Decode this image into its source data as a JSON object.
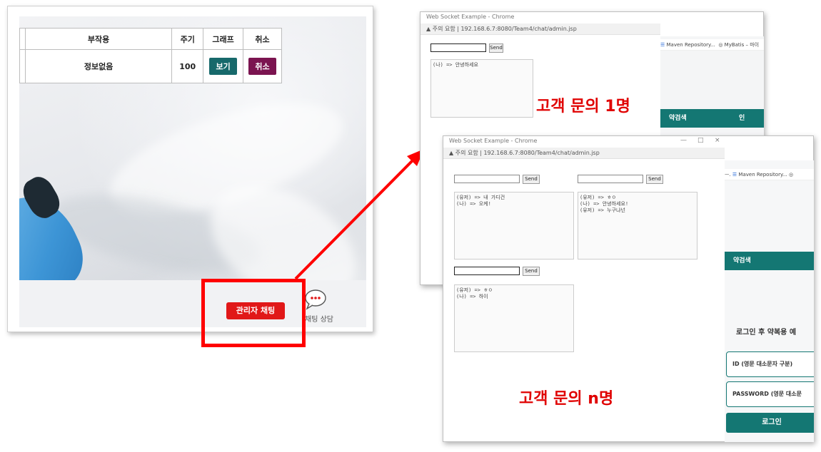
{
  "admin_page": {
    "table": {
      "headers": {
        "side_effect": "부작용",
        "cycle": "주기",
        "graph": "그래프",
        "cancel": "취소"
      },
      "row": {
        "side_effect": "정보없음",
        "cycle": "100",
        "view_button": "보기",
        "cancel_button": "취소"
      }
    },
    "admin_chat_button": "관리자 채팅",
    "chat_consult_label": "채팅 상담"
  },
  "window_single": {
    "title": "Web Socket Example - Chrome",
    "security": "주의 요함",
    "url": "192.168.6.7:8080/Team4/chat/admin.jsp",
    "send_label": "Send",
    "messages": [
      "(나) => 안녕하세요"
    ],
    "bookmarks": [
      "Maven Repository...",
      "MyBatis – 마이"
    ],
    "teal_labels": [
      "약검색",
      "인"
    ],
    "caption": "고객 문의 1명"
  },
  "window_multi": {
    "title": "Web Socket Example - Chrome",
    "window_controls": [
      "—",
      "□",
      "×"
    ],
    "security": "주의 요함",
    "url": "192.168.6.7:8080/Team4/chat/admin.jsp",
    "send_label": "Send",
    "chats": [
      {
        "messages": [
          "(유저) => 내 가디건",
          "(나) => 오케!"
        ]
      },
      {
        "messages": [
          "(유저) => ㅎㅇ",
          "(나) => 안녕하세요!",
          "(유저) => 누구냐넌"
        ]
      },
      {
        "messages": [
          "(유저) => ㅎㅇ",
          "(나) => 하이"
        ]
      }
    ],
    "bookmarks": [
      "Maven Repository..."
    ],
    "teal_label": "약검색",
    "login_prompt": "로그인 후 약복용 예",
    "id_placeholder": "ID (영문 대소문자 구분)",
    "password_placeholder": "PASSWORD (영문 대소문",
    "login_button": "로그인",
    "caption": "고객 문의 n명"
  }
}
